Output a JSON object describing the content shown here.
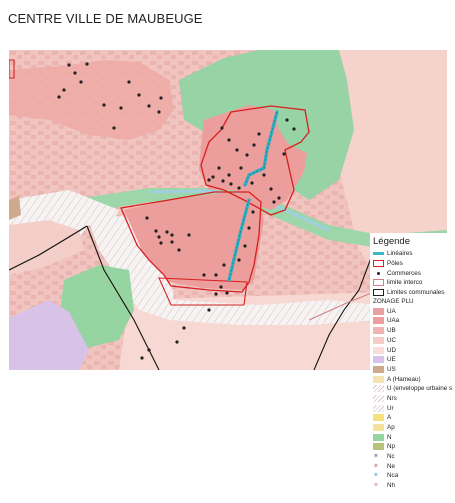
{
  "title": "CENTRE VILLE DE MAUBEUGE",
  "legend": {
    "title": "Légende",
    "overlays": [
      {
        "label": "Linéaires",
        "kind": "line",
        "color": "#3fb8c6"
      },
      {
        "label": "Pôles",
        "kind": "box",
        "color": "#e02020"
      },
      {
        "label": "Commerces",
        "kind": "dot",
        "color": "#222222"
      },
      {
        "label": "limite interco",
        "kind": "box",
        "color": "#d08080"
      },
      {
        "label": "Limites communales",
        "kind": "box",
        "color": "#222222"
      }
    ],
    "zonage_heading": "ZONAGE PLU",
    "zones": [
      {
        "label": "UA",
        "color": "#e8a0a0"
      },
      {
        "label": "UAa",
        "color": "#ee9e9e"
      },
      {
        "label": "UB",
        "color": "#f0b4b4"
      },
      {
        "label": "UC",
        "color": "#f6cdc8"
      },
      {
        "label": "UD",
        "color": "#f9ddd8"
      },
      {
        "label": "UE",
        "color": "#d9c2e8"
      },
      {
        "label": "US",
        "color": "#cfa98e"
      },
      {
        "label": "A (Hameau)",
        "color": "#f3e3b0"
      },
      {
        "label": "U (enveloppe urbaine s",
        "color": "#ffffff",
        "hatch": true
      },
      {
        "label": "Nrs",
        "color": "#f6f6ef",
        "hatch": true
      },
      {
        "label": "Ur",
        "color": "#ffffff",
        "hatch": true
      },
      {
        "label": "A",
        "color": "#f6e27a"
      },
      {
        "label": "Ap",
        "color": "#f3e39a"
      },
      {
        "label": "N",
        "color": "#96d4a2"
      },
      {
        "label": "Np",
        "color": "#b7c37a"
      },
      {
        "label": "Nc",
        "color": "#ffffff",
        "star": "#a070b0"
      },
      {
        "label": "Ne",
        "color": "#ffffff",
        "star": "#e07a7a"
      },
      {
        "label": "Nca",
        "color": "#ffffff",
        "star": "#7ab0d0"
      },
      {
        "label": "Nh",
        "color": "#ffffff",
        "star": "#e8a0a0"
      }
    ]
  }
}
